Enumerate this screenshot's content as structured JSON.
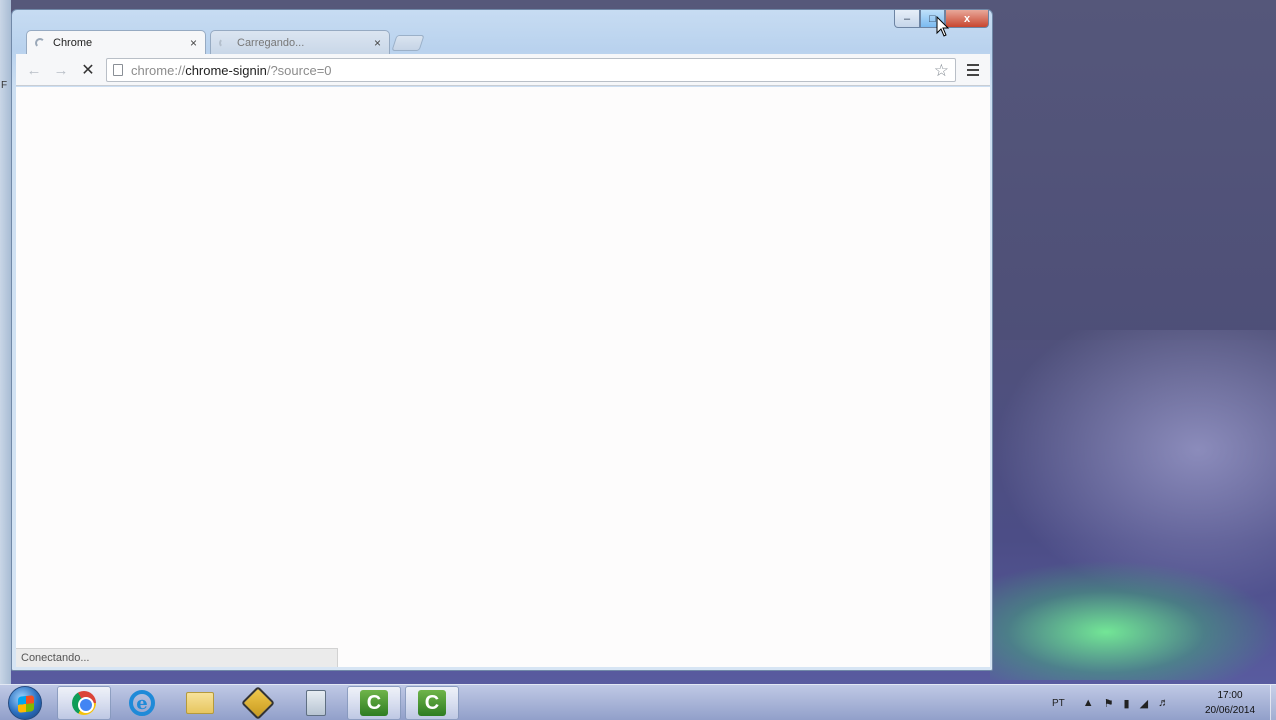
{
  "browser": {
    "tabs": [
      {
        "title": "Chrome",
        "state": "active"
      },
      {
        "title": "Carregando...",
        "state": "loading"
      }
    ],
    "tab_close_glyph": "×",
    "address": {
      "scheme": "chrome://",
      "host": "chrome-signin",
      "path": "/?source=0"
    },
    "status_text": "Conectando...",
    "window_controls": {
      "minimize": "–",
      "maximize": "□",
      "close": "x"
    }
  },
  "taskbar": {
    "pinned": [
      {
        "name": "chrome",
        "icon": "chrome-icon",
        "active": true
      },
      {
        "name": "internet-explorer",
        "icon": "ie-icon",
        "active": false
      },
      {
        "name": "file-explorer",
        "icon": "folder-icon",
        "active": false
      },
      {
        "name": "tool",
        "icon": "tool-icon",
        "active": false
      },
      {
        "name": "calculator",
        "icon": "calculator-icon",
        "active": false
      },
      {
        "name": "camtasia-1",
        "icon": "camtasia-icon",
        "active": true
      },
      {
        "name": "camtasia-2",
        "icon": "camtasia-icon",
        "active": true
      }
    ],
    "tray": {
      "language": "PT",
      "time": "17:00",
      "date": "20/06/2014"
    }
  },
  "edge_window_letter": "F",
  "colors": {
    "close_red": "#c8462f",
    "window_frame": "#b9d2ee",
    "wallpaper": "#50517a",
    "green_glow": "#78ff96"
  }
}
